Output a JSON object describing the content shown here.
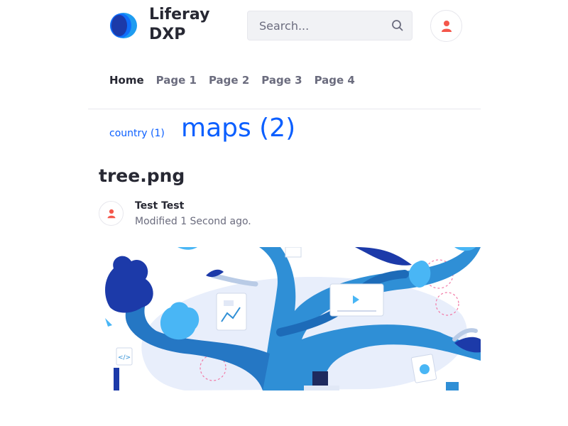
{
  "header": {
    "site_name": "Liferay DXP",
    "logo_icon": "liferay-logo",
    "search": {
      "placeholder": "Search...",
      "value": ""
    },
    "user_icon": "user-icon"
  },
  "nav": {
    "items": [
      {
        "label": "Home",
        "active": true
      },
      {
        "label": "Page 1",
        "active": false
      },
      {
        "label": "Page 2",
        "active": false
      },
      {
        "label": "Page 3",
        "active": false
      },
      {
        "label": "Page 4",
        "active": false
      }
    ]
  },
  "tag_cloud": {
    "tags": [
      {
        "label": "country (1)"
      },
      {
        "label": "maps (2)"
      }
    ]
  },
  "document": {
    "title": "tree.png",
    "author": "Test Test",
    "modified": "Modified 1 Second ago.",
    "preview_icon": "tree-illustration"
  },
  "colors": {
    "accent": "#0b5fff",
    "text_primary": "#272833",
    "text_secondary": "#6b6c7e",
    "avatar_icon": "#f4574b"
  }
}
